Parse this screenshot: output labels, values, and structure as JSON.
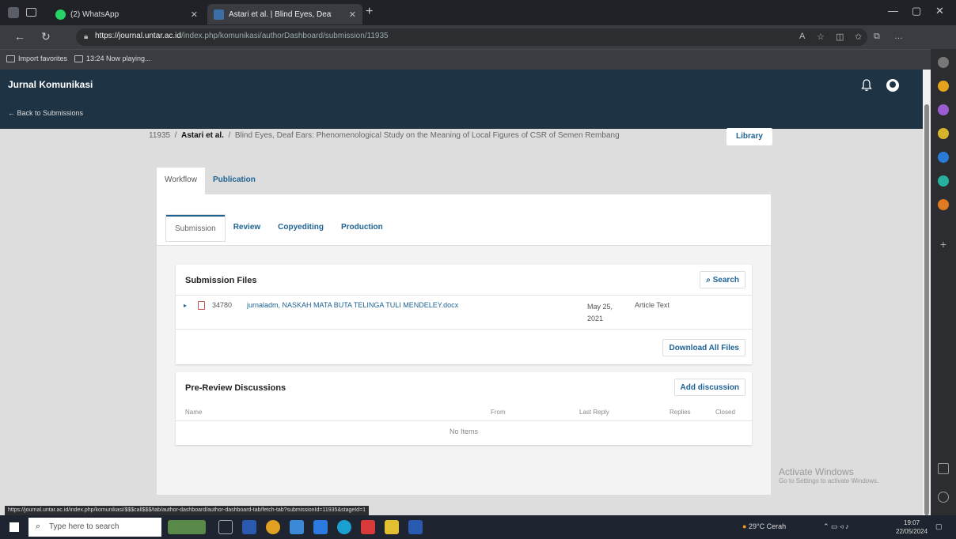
{
  "browser": {
    "tabs": [
      {
        "label": "(2) WhatsApp"
      },
      {
        "label": "Astari et al. | Blind Eyes, Deaf Ears"
      }
    ],
    "url_host": "https://journal.untar.ac.id",
    "url_path": "/index.php/komunikasi/authorDashboard/submission/11935",
    "favorites": [
      {
        "label": "Import favorites"
      },
      {
        "label": "13:24 Now playing..."
      }
    ]
  },
  "header": {
    "journal_title": "Jurnal Komunikasi",
    "back_link": "← Back to Submissions"
  },
  "breadcrumb": {
    "id": "11935",
    "sep": "/",
    "author": "Astari et al.",
    "title": "Blind Eyes, Deaf Ears: Phenomenological Study on the Meaning of Local Figures of CSR of Semen Rembang",
    "library_label": "Library"
  },
  "main_tabs": [
    {
      "label": "Workflow"
    },
    {
      "label": "Publication"
    }
  ],
  "stage_tabs": [
    {
      "label": "Submission"
    },
    {
      "label": "Review"
    },
    {
      "label": "Copyediting"
    },
    {
      "label": "Production"
    }
  ],
  "submission_files": {
    "title": "Submission Files",
    "search_label": "Search",
    "file": {
      "id": "34780",
      "name": "jurnaladm, NASKAH MATA BUTA TELINGA TULI MENDELEY.docx",
      "date_line1": "May 25,",
      "date_line2": "2021",
      "type": "Article Text"
    },
    "download_label": "Download All Files"
  },
  "discussions": {
    "title": "Pre-Review Discussions",
    "add_label": "Add discussion",
    "columns": [
      "Name",
      "From",
      "Last Reply",
      "Replies",
      "Closed"
    ],
    "empty": "No Items"
  },
  "status_url": "https://journal.untar.ac.id/index.php/komunikasi/$$$call$$$/tab/author-dashboard/author-dashboard-tab/fetch-tab?submissionId=11935&stageId=1",
  "watermark": {
    "title": "Activate Windows",
    "subtitle": "Go to Settings to activate Windows."
  },
  "taskbar": {
    "search_placeholder": "Type here to search",
    "weather": "29°C Cerah",
    "time": "19:07",
    "date": "22/05/2024"
  },
  "colors": {
    "header": "#1e3445",
    "link": "#1e6292"
  }
}
